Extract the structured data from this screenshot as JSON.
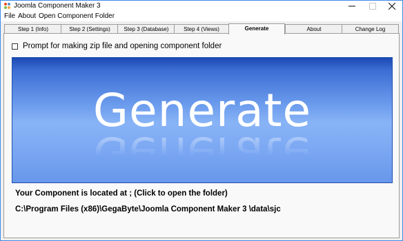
{
  "window": {
    "title": "Joomla Component Maker 3",
    "icon": "joomla-icon"
  },
  "menu": {
    "items": [
      "File",
      "About",
      "Open Component Folder"
    ]
  },
  "tabs": [
    {
      "label": "Step 1 (Info)",
      "active": false
    },
    {
      "label": "Step 2 (Settings)",
      "active": false
    },
    {
      "label": "Step 3 (Database)",
      "active": false
    },
    {
      "label": "Step 4 (Views)",
      "active": false
    },
    {
      "label": "Generate",
      "active": true
    },
    {
      "label": "About",
      "active": false
    },
    {
      "label": "Change Log",
      "active": false
    }
  ],
  "generate": {
    "checkbox_label": "Prompt for making zip file and opening component folder",
    "checkbox_checked": false,
    "banner_text": "Generate",
    "located_label": "Your Component is located at ; (Click to open the folder)",
    "path": "C:\\Program Files (x86)\\GegaByte\\Joomla Component Maker 3 \\data\\sjc"
  },
  "colors": {
    "banner_top": "#1b49b3",
    "banner_mid": "#88b3f6",
    "window_border": "#3c8be8"
  }
}
